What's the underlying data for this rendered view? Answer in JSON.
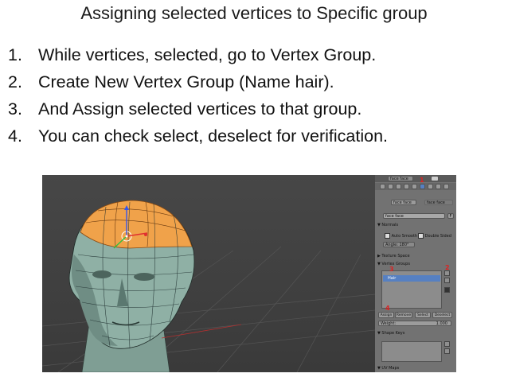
{
  "slide": {
    "title": "Assigning selected vertices to Specific group",
    "steps": [
      {
        "num": "1.",
        "text": "While vertices, selected, go to  Vertex Group."
      },
      {
        "num": "2.",
        "text": "Create New Vertex Group (Name hair)."
      },
      {
        "num": "3.",
        "text": "And Assign selected vertices to that group."
      },
      {
        "num": "4.",
        "text": "You can check select, deselect for verification."
      }
    ]
  },
  "panel": {
    "header_tab": "face face",
    "object_field": "face face",
    "mesh_field": "face face",
    "normals_header": "▼ Normals",
    "auto_smooth": "Auto Smooth",
    "double_sided": "Double Sided",
    "angle": "Angle: 180°",
    "texture_space": "▶ Texture Space",
    "vertex_groups_header": "▼ Vertex Groups",
    "group_name": "Hair",
    "assign": "Assign",
    "remove": "Remove",
    "select": "Select",
    "deselect": "Deselect",
    "weight_label": "Weight:",
    "weight_value": "1.000",
    "shape_keys_header": "▼ Shape Keys",
    "uv_maps_header": "▼ UV Maps",
    "annotation_marks": [
      "1",
      "2",
      "3",
      "4"
    ],
    "colors": {
      "selection": "#5680c2",
      "mesh_selected": "#f0a24a",
      "annotation": "#dd2222"
    }
  }
}
